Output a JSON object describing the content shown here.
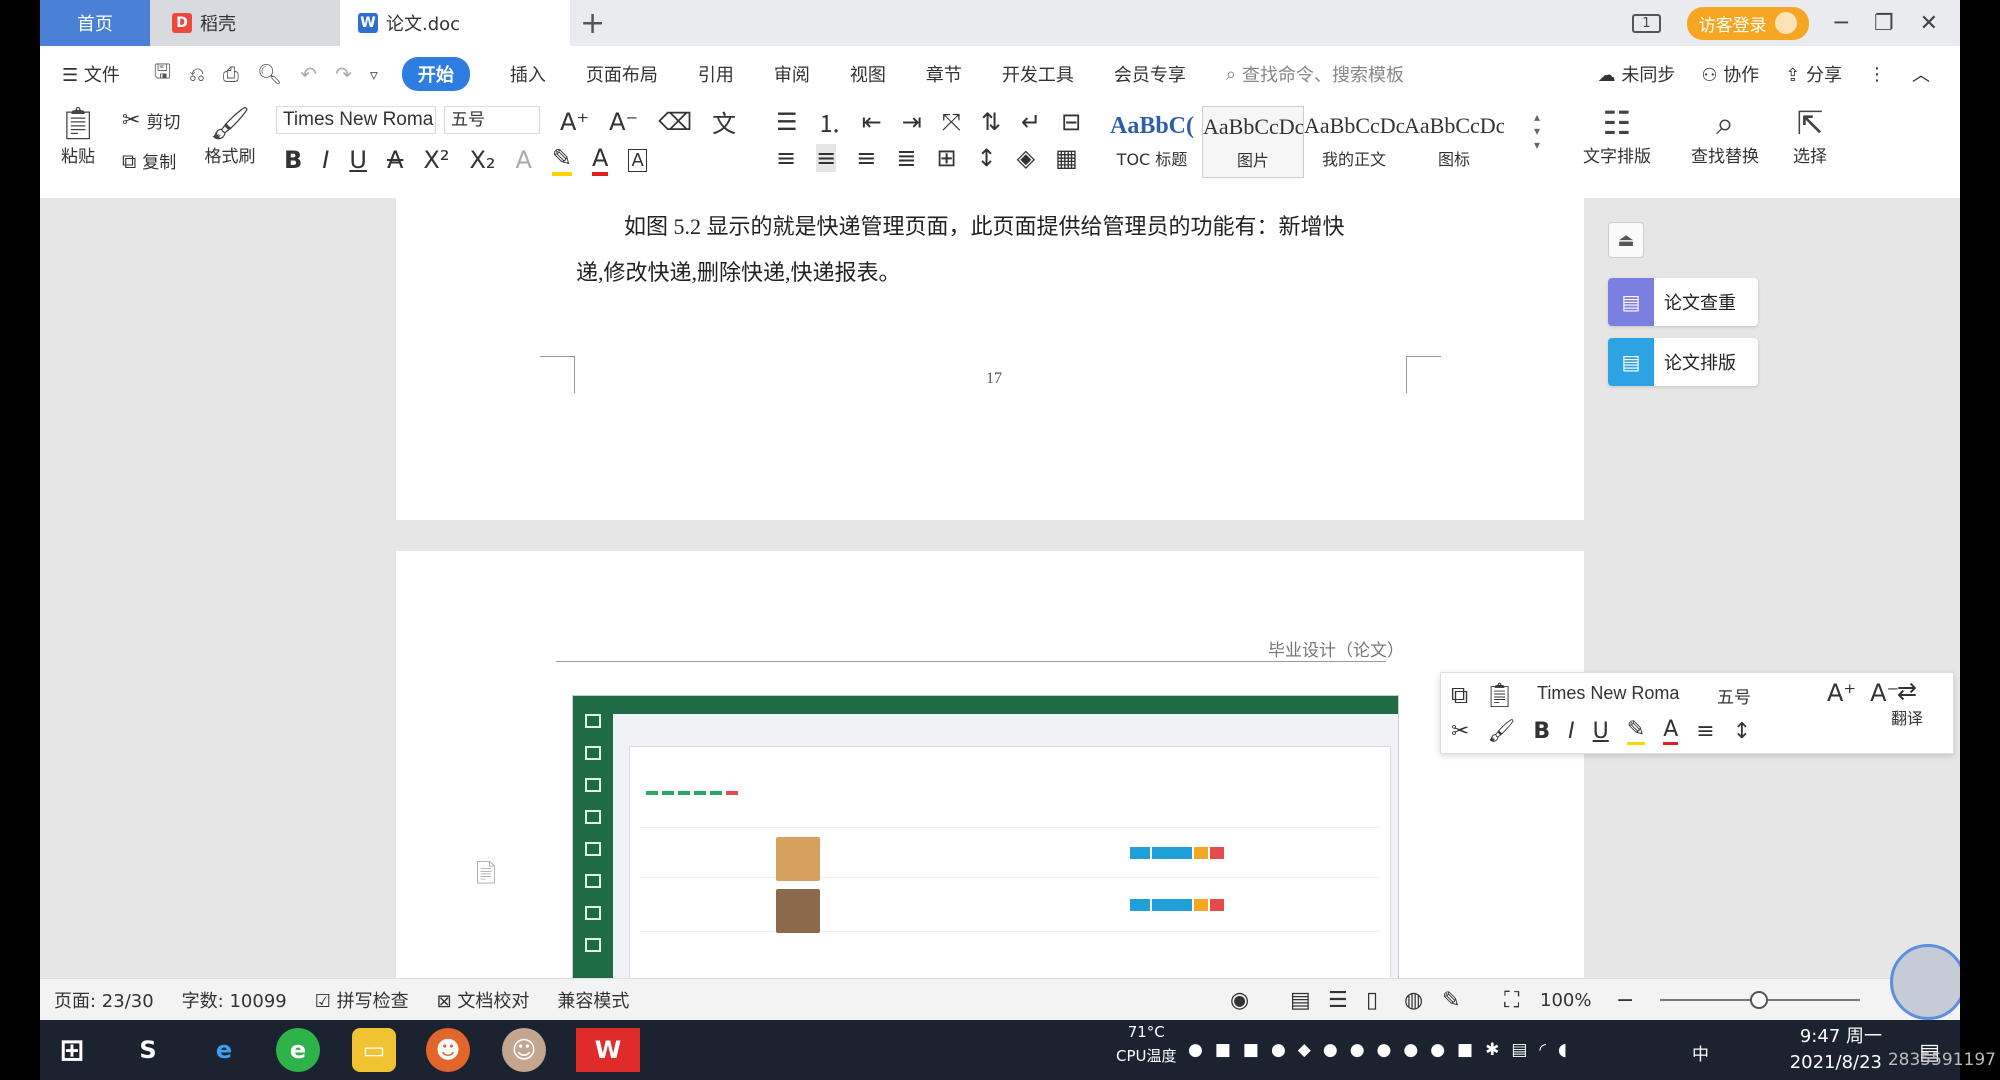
{
  "tabs": {
    "home": "首页",
    "docer": "稻壳",
    "document": "论文.doc",
    "new_tab": "+"
  },
  "titlebar": {
    "login": "访客登录",
    "panel_count": "1"
  },
  "menu": {
    "file": "文件",
    "items": [
      "开始",
      "插入",
      "页面布局",
      "引用",
      "审阅",
      "视图",
      "章节",
      "开发工具",
      "会员专享"
    ],
    "search_placeholder": "查找命令、搜索模板",
    "sync": "未同步",
    "collab": "协作",
    "share": "分享"
  },
  "ribbon": {
    "paste": "粘贴",
    "cut": "剪切",
    "copy": "复制",
    "format_painter": "格式刷",
    "font_name": "Times New Roma",
    "font_size": "五号",
    "styles": [
      {
        "sample": "AaBbC(",
        "name": "TOC 标题"
      },
      {
        "sample": "AaBbCcDc",
        "name": "图片"
      },
      {
        "sample": "AaBbCcDc",
        "name": "我的正文"
      },
      {
        "sample": "AaBbCcDc",
        "name": "图标"
      }
    ],
    "text_layout": "文字排版",
    "find_replace": "查找替换",
    "select": "选择"
  },
  "document": {
    "paragraph_line1": "如图 5.2 显示的就是快递管理页面，此页面提供给管理员的功能有：新增快",
    "paragraph_line2": "递,修改快递,删除快递,快递报表。",
    "page_number": "17",
    "header_text": "毕业设计（论文）"
  },
  "side_pane": {
    "check": "论文查重",
    "layout": "论文排版"
  },
  "float_toolbar": {
    "font_name": "Times New Roma",
    "font_size": "五号",
    "translate": "翻译"
  },
  "statusbar": {
    "page": "页面: 23/30",
    "words": "字数: 10099",
    "spell": "拼写检查",
    "proof": "文档校对",
    "compat": "兼容模式",
    "zoom": "100%"
  },
  "taskbar": {
    "cpu_temp": "71°C",
    "cpu_label": "CPU温度",
    "ime": "中",
    "time": "9:47 周一",
    "date": "2021/8/23",
    "watermark": "2835591197"
  }
}
